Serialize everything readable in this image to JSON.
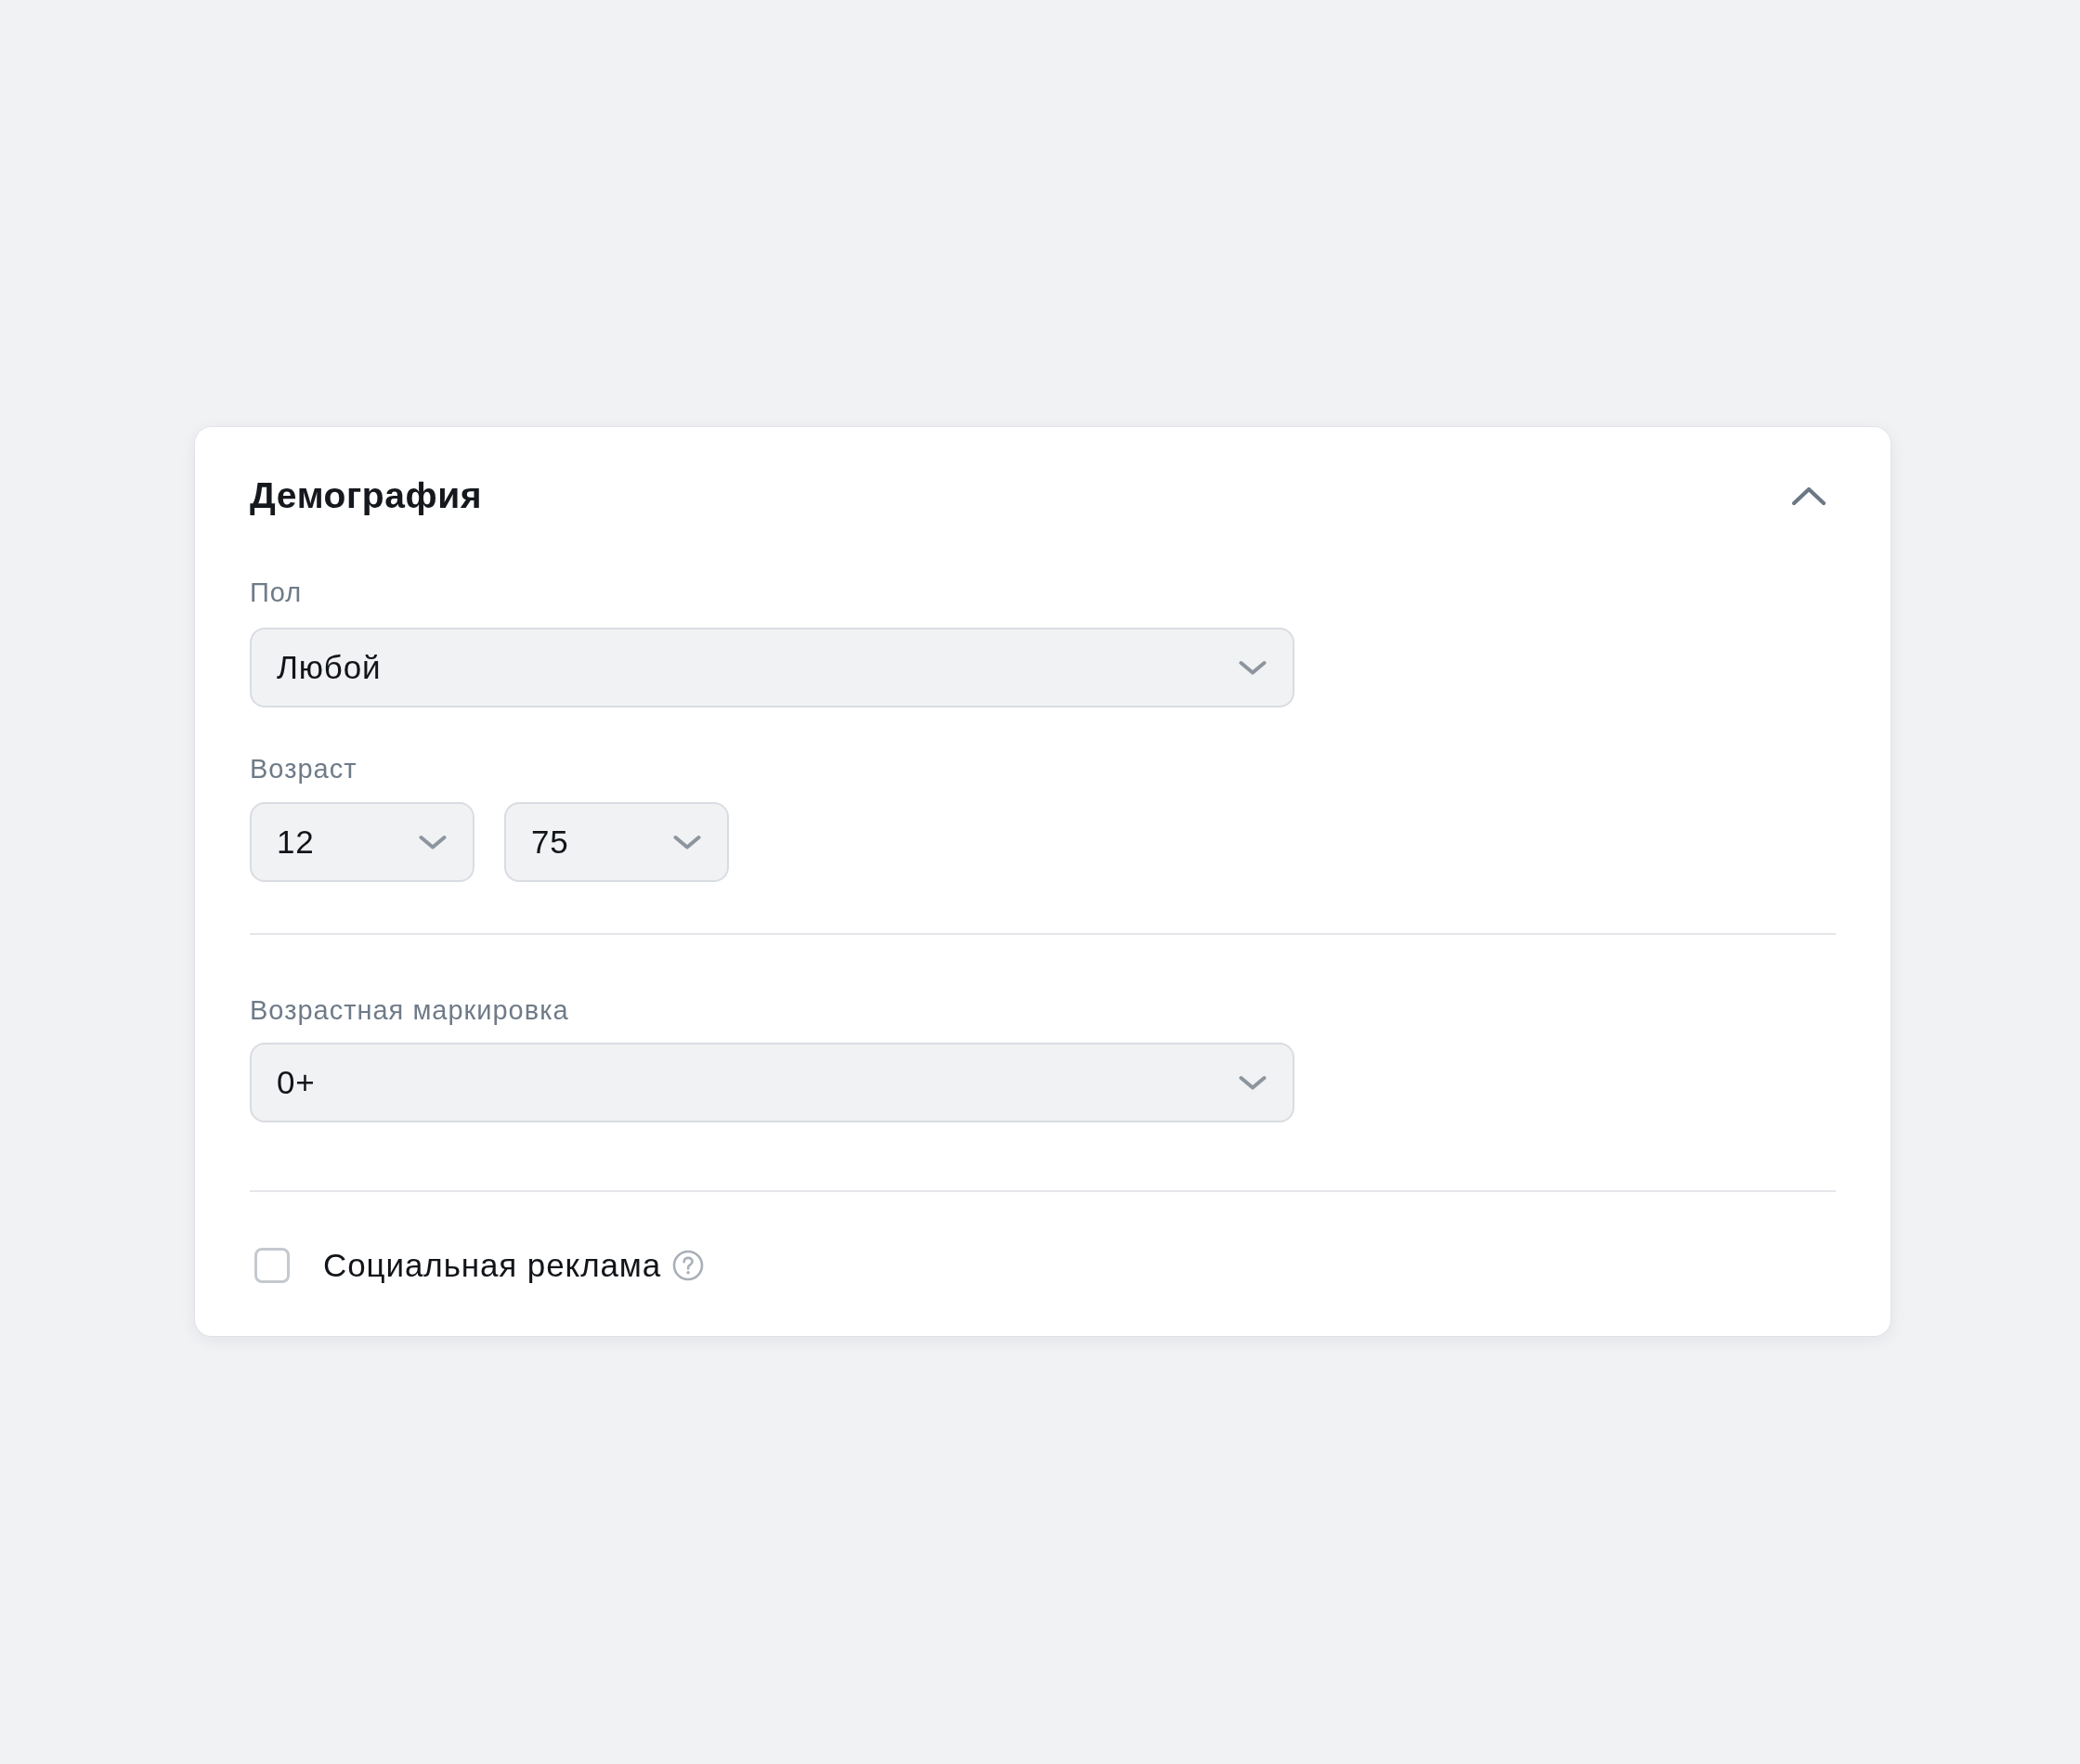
{
  "section": {
    "title": "Демография",
    "expanded": true
  },
  "gender": {
    "label": "Пол",
    "value": "Любой"
  },
  "age": {
    "label": "Возраст",
    "from": "12",
    "to": "75"
  },
  "age_rating": {
    "label": "Возрастная маркировка",
    "value": "0+"
  },
  "social_ad": {
    "label": "Социальная реклама",
    "checked": false
  }
}
